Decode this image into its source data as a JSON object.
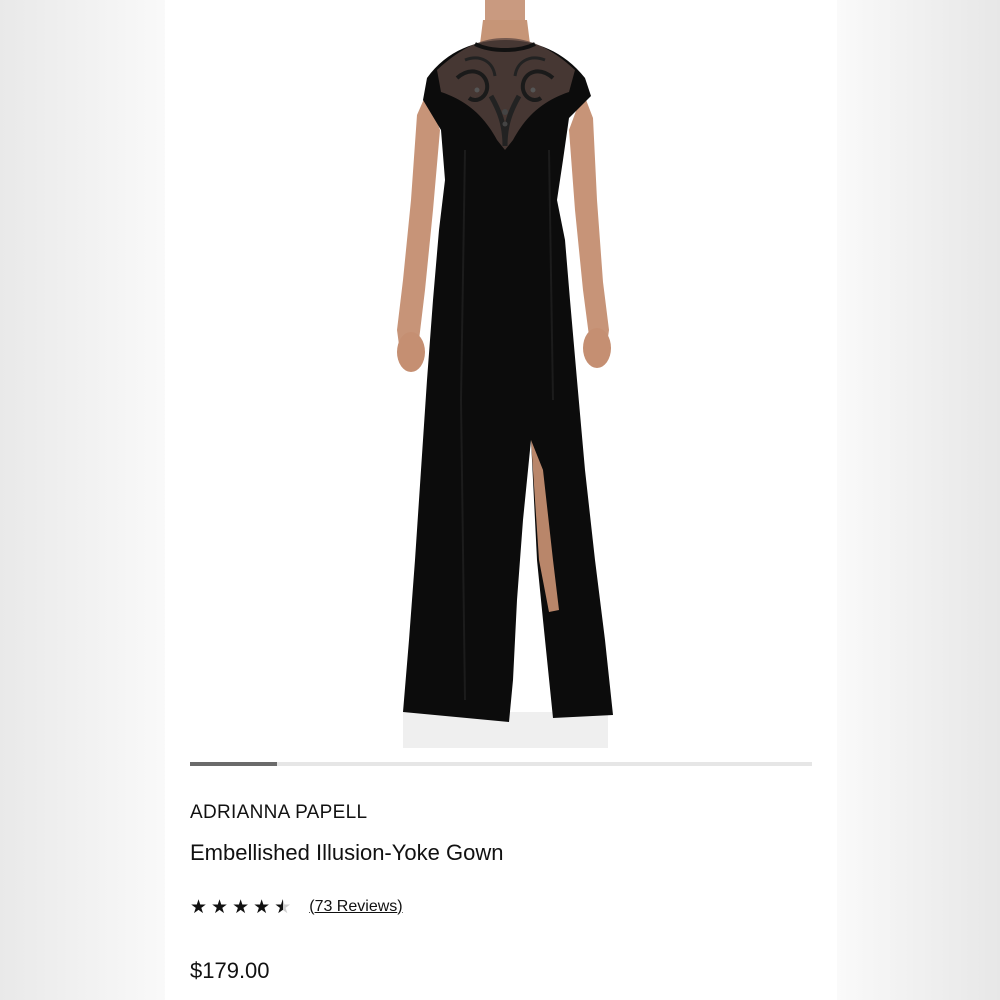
{
  "product": {
    "image_alt": "Model wearing black floor-length gown with sequined illusion yoke",
    "brand": "ADRIANNA PAPELL",
    "name": "Embellished Illusion-Yoke Gown",
    "rating_value": 4.5,
    "rating_max": 5,
    "reviews_text": "73 Reviews",
    "price": "$179.00"
  },
  "carousel": {
    "progress_fraction": 0.14
  },
  "colors": {
    "background": "#ffffff",
    "text": "#111111",
    "carousel_track": "#e6e6e6",
    "carousel_fill": "#6b6b6b",
    "gown": "#0c0c0c"
  },
  "icons": {
    "star_full": "star-icon",
    "star_half": "star-half-icon"
  }
}
